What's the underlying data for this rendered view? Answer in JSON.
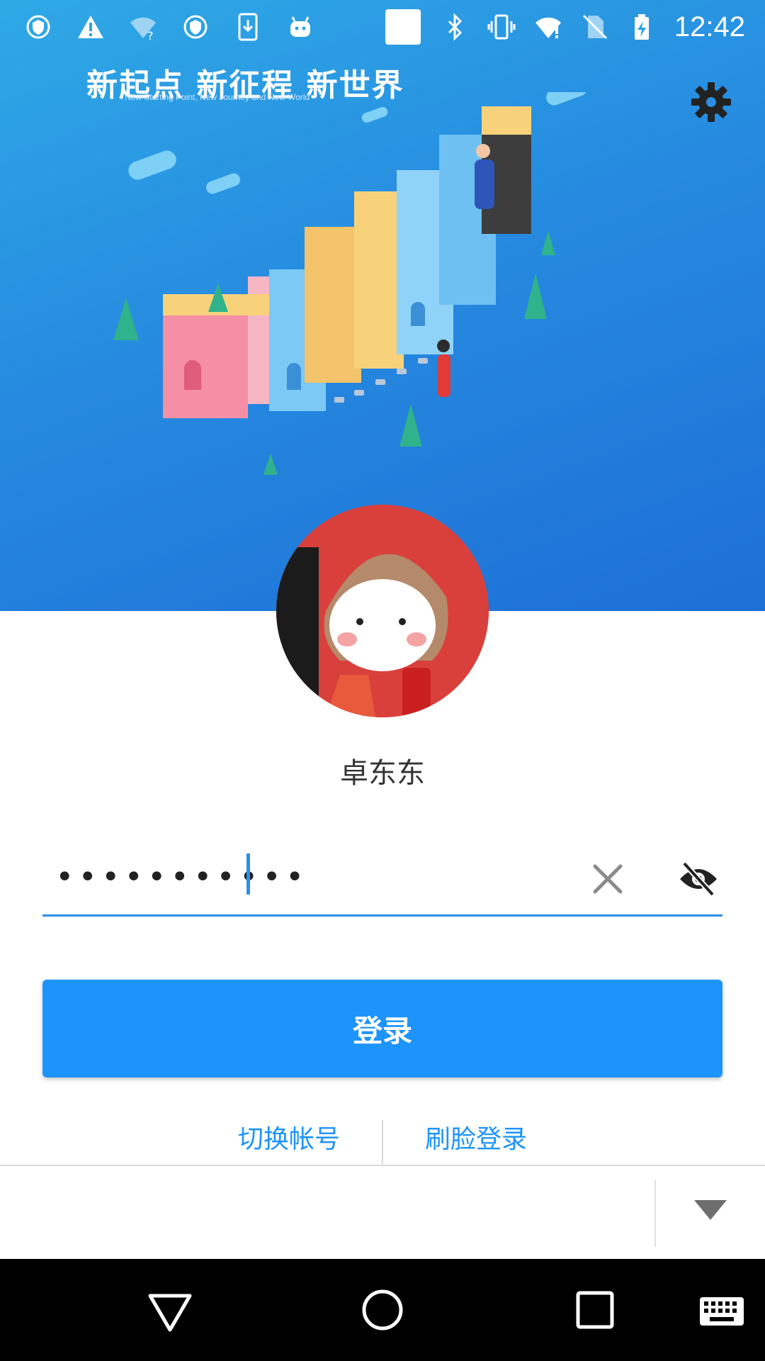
{
  "status_bar": {
    "time": "12:42",
    "left_icons": [
      "vpn-shield-icon",
      "warning-icon",
      "wifi-question-icon",
      "vpn-shield-icon",
      "download-icon",
      "android-icon"
    ],
    "right_icons": [
      "square-icon",
      "bluetooth-icon",
      "vibrate-icon",
      "wifi-alert-icon",
      "no-sim-icon",
      "battery-charging-icon"
    ]
  },
  "hero": {
    "title": "新起点 新征程 新世界",
    "subtitle": "New Starting Point, New Journey and New World",
    "illustration_text": "New World"
  },
  "user": {
    "name": "卓东东"
  },
  "password": {
    "masked_value": "•••••••••••"
  },
  "buttons": {
    "login": "登录",
    "switch_account": "切换帐号",
    "face_login": "刷脸登录"
  },
  "colors": {
    "accent": "#1d94fb",
    "hero_top": "#2fa9e6",
    "hero_bottom": "#1e6fd6",
    "avatar_bg": "#d9403c"
  }
}
